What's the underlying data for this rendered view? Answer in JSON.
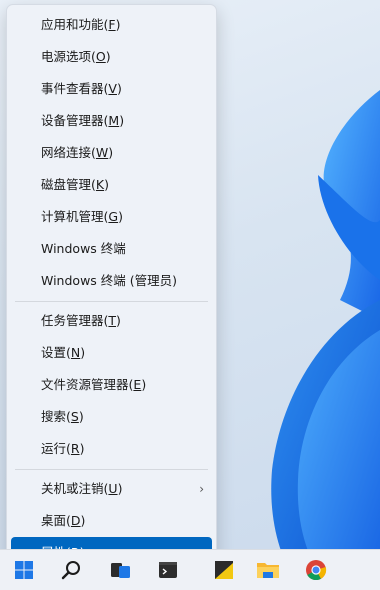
{
  "menu": {
    "items": [
      {
        "id": "apps-features",
        "label": "应用和功能",
        "key": "F"
      },
      {
        "id": "power-options",
        "label": "电源选项",
        "key": "O"
      },
      {
        "id": "event-viewer",
        "label": "事件查看器",
        "key": "V"
      },
      {
        "id": "device-manager",
        "label": "设备管理器",
        "key": "M"
      },
      {
        "id": "network-connections",
        "label": "网络连接",
        "key": "W"
      },
      {
        "id": "disk-management",
        "label": "磁盘管理",
        "key": "K"
      },
      {
        "id": "computer-management",
        "label": "计算机管理",
        "key": "G"
      },
      {
        "id": "windows-terminal",
        "label": "Windows 终端",
        "key": ""
      },
      {
        "id": "windows-terminal-admin",
        "label": "Windows 终端 (管理员)",
        "key": ""
      },
      {
        "id": "task-manager",
        "label": "任务管理器",
        "key": "T"
      },
      {
        "id": "settings",
        "label": "设置",
        "key": "N"
      },
      {
        "id": "file-explorer",
        "label": "文件资源管理器",
        "key": "E"
      },
      {
        "id": "search",
        "label": "搜索",
        "key": "S"
      },
      {
        "id": "run",
        "label": "运行",
        "key": "R"
      },
      {
        "id": "shutdown-signout",
        "label": "关机或注销",
        "key": "U"
      },
      {
        "id": "desktop",
        "label": "桌面",
        "key": "D"
      },
      {
        "id": "properties",
        "label": "属性",
        "key": "R"
      }
    ],
    "submenu_arrow": "›"
  },
  "taskbar": {
    "icons": [
      "windows-start-icon",
      "search-icon",
      "task-view-icon",
      "terminal-icon",
      "sticky-notes-icon",
      "file-explorer-icon",
      "chrome-icon"
    ]
  },
  "colors": {
    "highlight": "#0067c0",
    "menu_bg": "#eef2f8",
    "accent_blue": "#1e78e6"
  }
}
